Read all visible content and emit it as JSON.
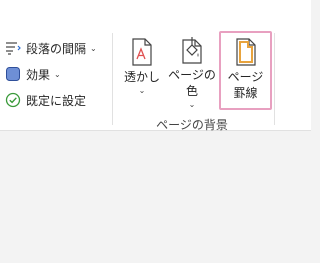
{
  "ribbon": {
    "paragraph_spacing_label": "段落の間隔",
    "effects_label": "効果",
    "set_default_label": "既定に設定",
    "watermark_label": "透かし",
    "page_color_label": "ページの色",
    "page_borders_line1": "ページ",
    "page_borders_line2": "罫線",
    "group_label": "ページの背景",
    "dropdown_glyph": "⌄"
  },
  "colors": {
    "highlight_border": "#e8a0c0",
    "page_border_icon": "#e8a33d",
    "check_green": "#3a9a3a",
    "watermark_red": "#e05050"
  },
  "icons": {
    "paragraph_spacing": "paragraph-spacing-icon",
    "effects": "effects-icon",
    "set_default": "checkmark-circle-icon",
    "watermark": "watermark-page-icon",
    "page_color": "paint-bucket-page-icon",
    "page_borders": "page-border-icon"
  }
}
